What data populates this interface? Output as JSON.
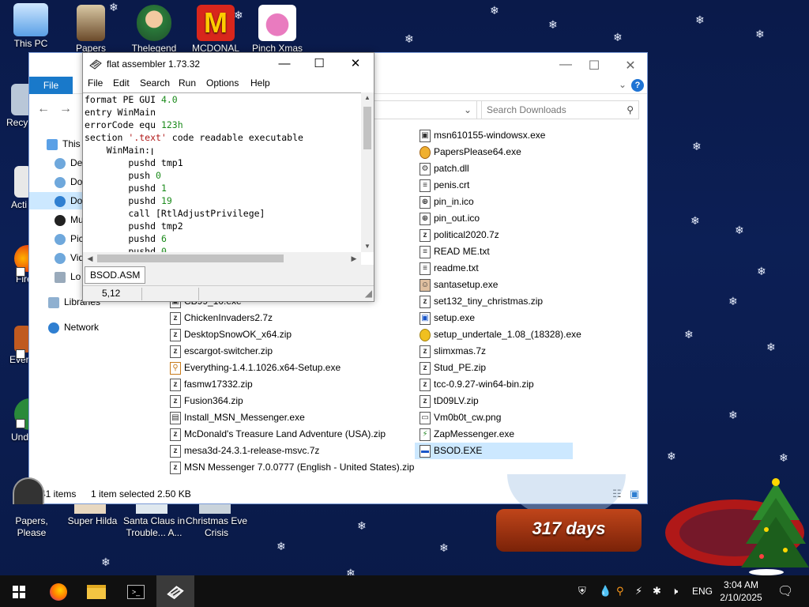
{
  "desktop": {
    "icons_left": [
      {
        "label": "This PC"
      },
      {
        "label": "Recy"
      },
      {
        "label": "Acti"
      },
      {
        "label": "Fire"
      },
      {
        "label": "Every"
      },
      {
        "label": "Und"
      }
    ],
    "icons_top": [
      {
        "label": "Papers"
      },
      {
        "label": "Thelegend"
      },
      {
        "label": "MCDONAL"
      },
      {
        "label": "Pinch Xmas"
      }
    ],
    "icons_bottom": [
      {
        "label1": "Papers, Please",
        "label2": ""
      },
      {
        "label1": "Super Hilda",
        "label2": ""
      },
      {
        "label1": "Santa Claus in",
        "label2": "Trouble... A..."
      },
      {
        "label1": "Christmas Eve",
        "label2": "Crisis"
      }
    ]
  },
  "explorer": {
    "ribbon": {
      "file_tab": "File",
      "help": "?"
    },
    "search_placeholder": "Search Downloads",
    "nav": [
      {
        "label": "This"
      },
      {
        "label": "De"
      },
      {
        "label": "Do"
      },
      {
        "label": "Do"
      },
      {
        "label": "Mu"
      },
      {
        "label": "Pic"
      },
      {
        "label": "Vid"
      },
      {
        "label": "Lo"
      },
      {
        "label": "Libraries"
      },
      {
        "label": "Network"
      }
    ],
    "files_col1": [
      "CB99_10.exe",
      "ChickenInvaders2.7z",
      "DesktopSnowOK_x64.zip",
      "escargot-switcher.zip",
      "Everything-1.4.1.1026.x64-Setup.exe",
      "fasmw17332.zip",
      "Fusion364.zip",
      "Install_MSN_Messenger.exe",
      "McDonald's Treasure Land Adventure (USA).zip",
      "mesa3d-24.3.1-release-msvc.7z",
      "MSN Messenger 7.0.0777 (English - United States).zip"
    ],
    "files_col2": [
      "msn610155-windowsx.exe",
      "PapersPlease64.exe",
      "patch.dll",
      "penis.crt",
      "pin_in.ico",
      "pin_out.ico",
      "political2020.7z",
      "READ ME.txt",
      "readme.txt",
      "santasetup.exe",
      "set132_tiny_christmas.zip",
      "setup.exe",
      "setup_undertale_1.08_(18328).exe",
      "slimxmas.7z",
      "Stud_PE.zip",
      "tcc-0.9.27-win64-bin.zip",
      "tD09LV.zip",
      "Vm0b0t_cw.png",
      "ZapMessenger.exe",
      "BSOD.EXE"
    ],
    "status": {
      "items": "41 items",
      "selected": "1 item selected  2.50 KB"
    }
  },
  "fasm": {
    "title": "flat assembler 1.73.32",
    "menu": [
      "File",
      "Edit",
      "Search",
      "Run",
      "Options",
      "Help"
    ],
    "code_lines": [
      {
        "a": "format PE GUI ",
        "n": "4.0",
        "b": ""
      },
      {
        "a": "entry WinMain",
        "n": "",
        "b": ""
      },
      {
        "a": "errorCode equ ",
        "n": "123h",
        "b": ""
      },
      {
        "a": "section ",
        "s": "'.text'",
        "b": " code readable executable"
      },
      {
        "a": "    WinMain:",
        "n": "",
        "b": ""
      },
      {
        "a": "        pushd tmp1",
        "n": "",
        "b": ""
      },
      {
        "a": "        push ",
        "n": "0",
        "b": ""
      },
      {
        "a": "        pushd ",
        "n": "1",
        "b": ""
      },
      {
        "a": "        pushd ",
        "n": "19",
        "b": ""
      },
      {
        "a": "        call [RtlAdjustPrivilege]",
        "n": "",
        "b": ""
      },
      {
        "a": "        pushd tmp2",
        "n": "",
        "b": ""
      },
      {
        "a": "        pushd ",
        "n": "6",
        "b": ""
      },
      {
        "a": "        pushd ",
        "n": "0",
        "b": ""
      }
    ],
    "tab": "BSOD.ASM",
    "position": "5,12"
  },
  "gadget": {
    "days": "317 days"
  },
  "taskbar": {
    "language": "ENG",
    "time": "3:04 AM",
    "date": "2/10/2025"
  }
}
